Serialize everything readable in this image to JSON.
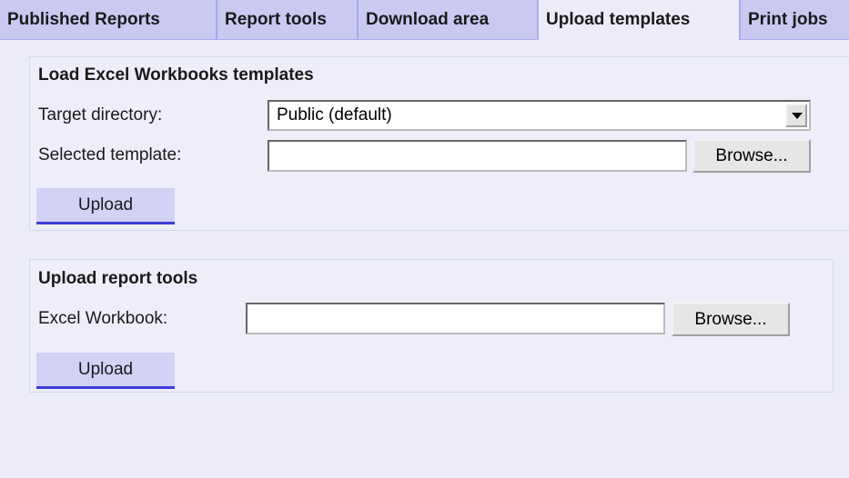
{
  "tabs": [
    {
      "label": "Published Reports",
      "active": false
    },
    {
      "label": "Report tools",
      "active": false
    },
    {
      "label": "Download area",
      "active": false
    },
    {
      "label": "Upload templates",
      "active": true
    },
    {
      "label": "Print jobs",
      "active": false
    }
  ],
  "load_templates": {
    "title": "Load Excel Workbooks templates",
    "target_dir_label": "Target directory:",
    "target_dir_value": "Public (default)",
    "selected_template_label": "Selected template:",
    "selected_template_value": "",
    "browse_label": "Browse...",
    "upload_label": "Upload"
  },
  "report_tools": {
    "title": "Upload report tools",
    "workbook_label": "Excel Workbook:",
    "workbook_value": "",
    "browse_label": "Browse...",
    "upload_label": "Upload"
  },
  "colors": {
    "tab_bg": "#c9c9f2",
    "active_tab_bg": "#ececf9",
    "upload_underline": "#3c3cd8"
  }
}
